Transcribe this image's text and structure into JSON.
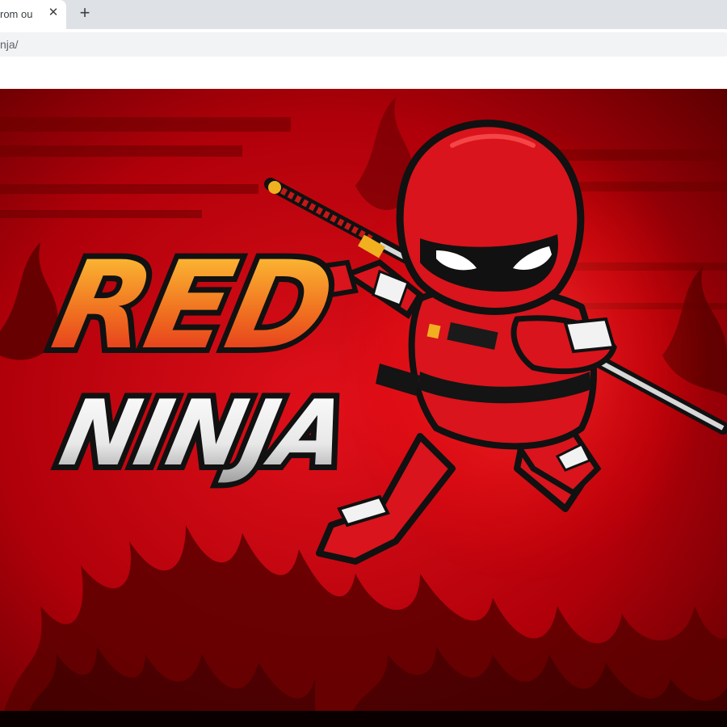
{
  "browser": {
    "tab": {
      "title": "rom our",
      "close_glyph": "✕"
    },
    "new_tab_glyph": "+",
    "address_bar": {
      "url": "nja/"
    }
  },
  "banner": {
    "logo_line1": "RED",
    "logo_line2": "NINJA",
    "colors": {
      "background": "#c8000a",
      "flame_dark": "#5a0000",
      "logo_fill_top": "#ffcc33",
      "logo_fill_bottom": "#e8201a",
      "ninja_red": "#d9141c"
    },
    "icons": [
      "ninja-mascot",
      "katana"
    ]
  }
}
